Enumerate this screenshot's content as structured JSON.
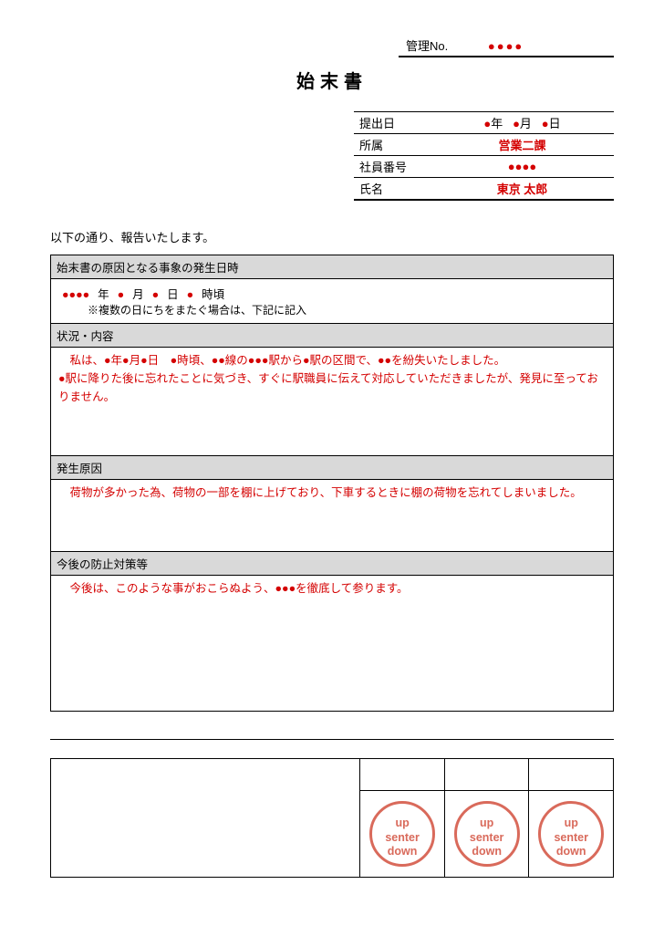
{
  "mgmt": {
    "label": "管理No.",
    "value": "●●●●"
  },
  "title": "始末書",
  "info": {
    "date_label": "提出日",
    "date_value_y": "●",
    "date_unit_y": "年",
    "date_value_m": "●",
    "date_unit_m": "月",
    "date_value_d": "●",
    "date_unit_d": "日",
    "dept_label": "所属",
    "dept_value": "営業二課",
    "emp_label": "社員番号",
    "emp_value": "●●●●",
    "name_label": "氏名",
    "name_value": "東京 太郎"
  },
  "intro": "以下の通り、報告いたします。",
  "section1": {
    "header": "始末書の原因となる事象の発生日時",
    "dots": "●●●●",
    "y": "●",
    "y_u": "年",
    "m": "●",
    "m_u": "月",
    "d": "●",
    "d_u": "日",
    "t": "●",
    "t_u": "時頃",
    "note": "※複数の日にちをまたぐ場合は、下記に記入"
  },
  "section2": {
    "header": "状況・内容",
    "line1": "　私は、●年●月●日　●時頃、●●線の●●●駅から●駅の区間で、●●を紛失いたしました。",
    "line2": "●駅に降りた後に忘れたことに気づき、すぐに駅職員に伝えて対応していただきましたが、発見に至っておりません。"
  },
  "section3": {
    "header": "発生原因",
    "line1": "　荷物が多かった為、荷物の一部を棚に上げており、下車するときに棚の荷物を忘れてしまいました。"
  },
  "section4": {
    "header": "今後の防止対策等",
    "line1": "　今後は、このような事がおこらぬよう、●●●を徹底して参ります。"
  },
  "stamp": {
    "l1": "up",
    "l2": "senter",
    "l3": "down"
  }
}
